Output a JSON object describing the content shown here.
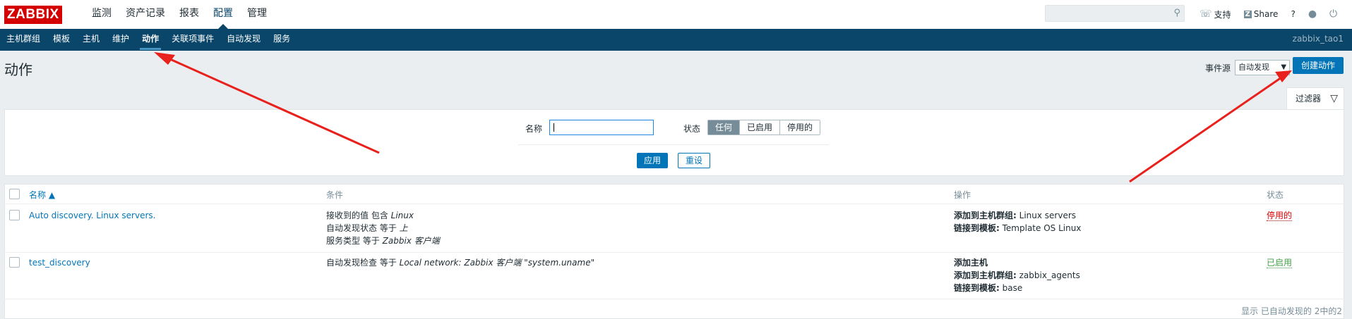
{
  "app": {
    "logo": "ZABBIX"
  },
  "main_nav": [
    "监测",
    "资产记录",
    "报表",
    "配置",
    "管理"
  ],
  "main_nav_active": "配置",
  "top_links": {
    "support": "支持",
    "share": "Share",
    "help": "?",
    "user_icon": "user-icon",
    "logout_icon": "power-icon"
  },
  "search": {
    "placeholder": ""
  },
  "sub_nav": [
    "主机群组",
    "模板",
    "主机",
    "维护",
    "动作",
    "关联项事件",
    "自动发现",
    "服务"
  ],
  "sub_nav_active": "动作",
  "username": "zabbix_tao1",
  "page": {
    "title": "动作",
    "event_source_label": "事件源",
    "event_source_value": "自动发现",
    "create_button": "创建动作"
  },
  "filter": {
    "tab_label": "过滤器",
    "name_label": "名称",
    "name_value": "",
    "status_label": "状态",
    "status_options": [
      "任何",
      "已启用",
      "停用的"
    ],
    "status_selected": "任何",
    "apply": "应用",
    "reset": "重设"
  },
  "table": {
    "headers": {
      "name": "名称 ▲",
      "conditions": "条件",
      "operations": "操作",
      "status": "状态"
    },
    "rows": [
      {
        "name": "Auto discovery. Linux servers.",
        "conditions": [
          {
            "text": "接收到的值 包含 ",
            "value": "Linux"
          },
          {
            "text": "自动发现状态 等于 ",
            "value": "上"
          },
          {
            "text": "服务类型 等于 ",
            "value": "Zabbix 客户端"
          }
        ],
        "operations": [
          {
            "label": "添加到主机群组:",
            "value": " Linux servers"
          },
          {
            "label": "链接到模板:",
            "value": " Template OS Linux"
          }
        ],
        "status": "停用的"
      },
      {
        "name": "test_discovery",
        "conditions": [
          {
            "text": "自动发现检查 等于 ",
            "value": "Local network: Zabbix 客户端 \"system.uname\""
          }
        ],
        "operations": [
          {
            "label": "添加主机",
            "value": ""
          },
          {
            "label": "添加到主机群组:",
            "value": " zabbix_agents"
          },
          {
            "label": "链接到模板:",
            "value": " base"
          }
        ],
        "status": "已启用"
      }
    ],
    "footer": "显示 已自动发现的 2中的2"
  },
  "colors": {
    "nav_bg": "#0a466a",
    "primary": "#0275b8",
    "logo": "#d40000",
    "annotation_arrow": "#e8211c"
  }
}
